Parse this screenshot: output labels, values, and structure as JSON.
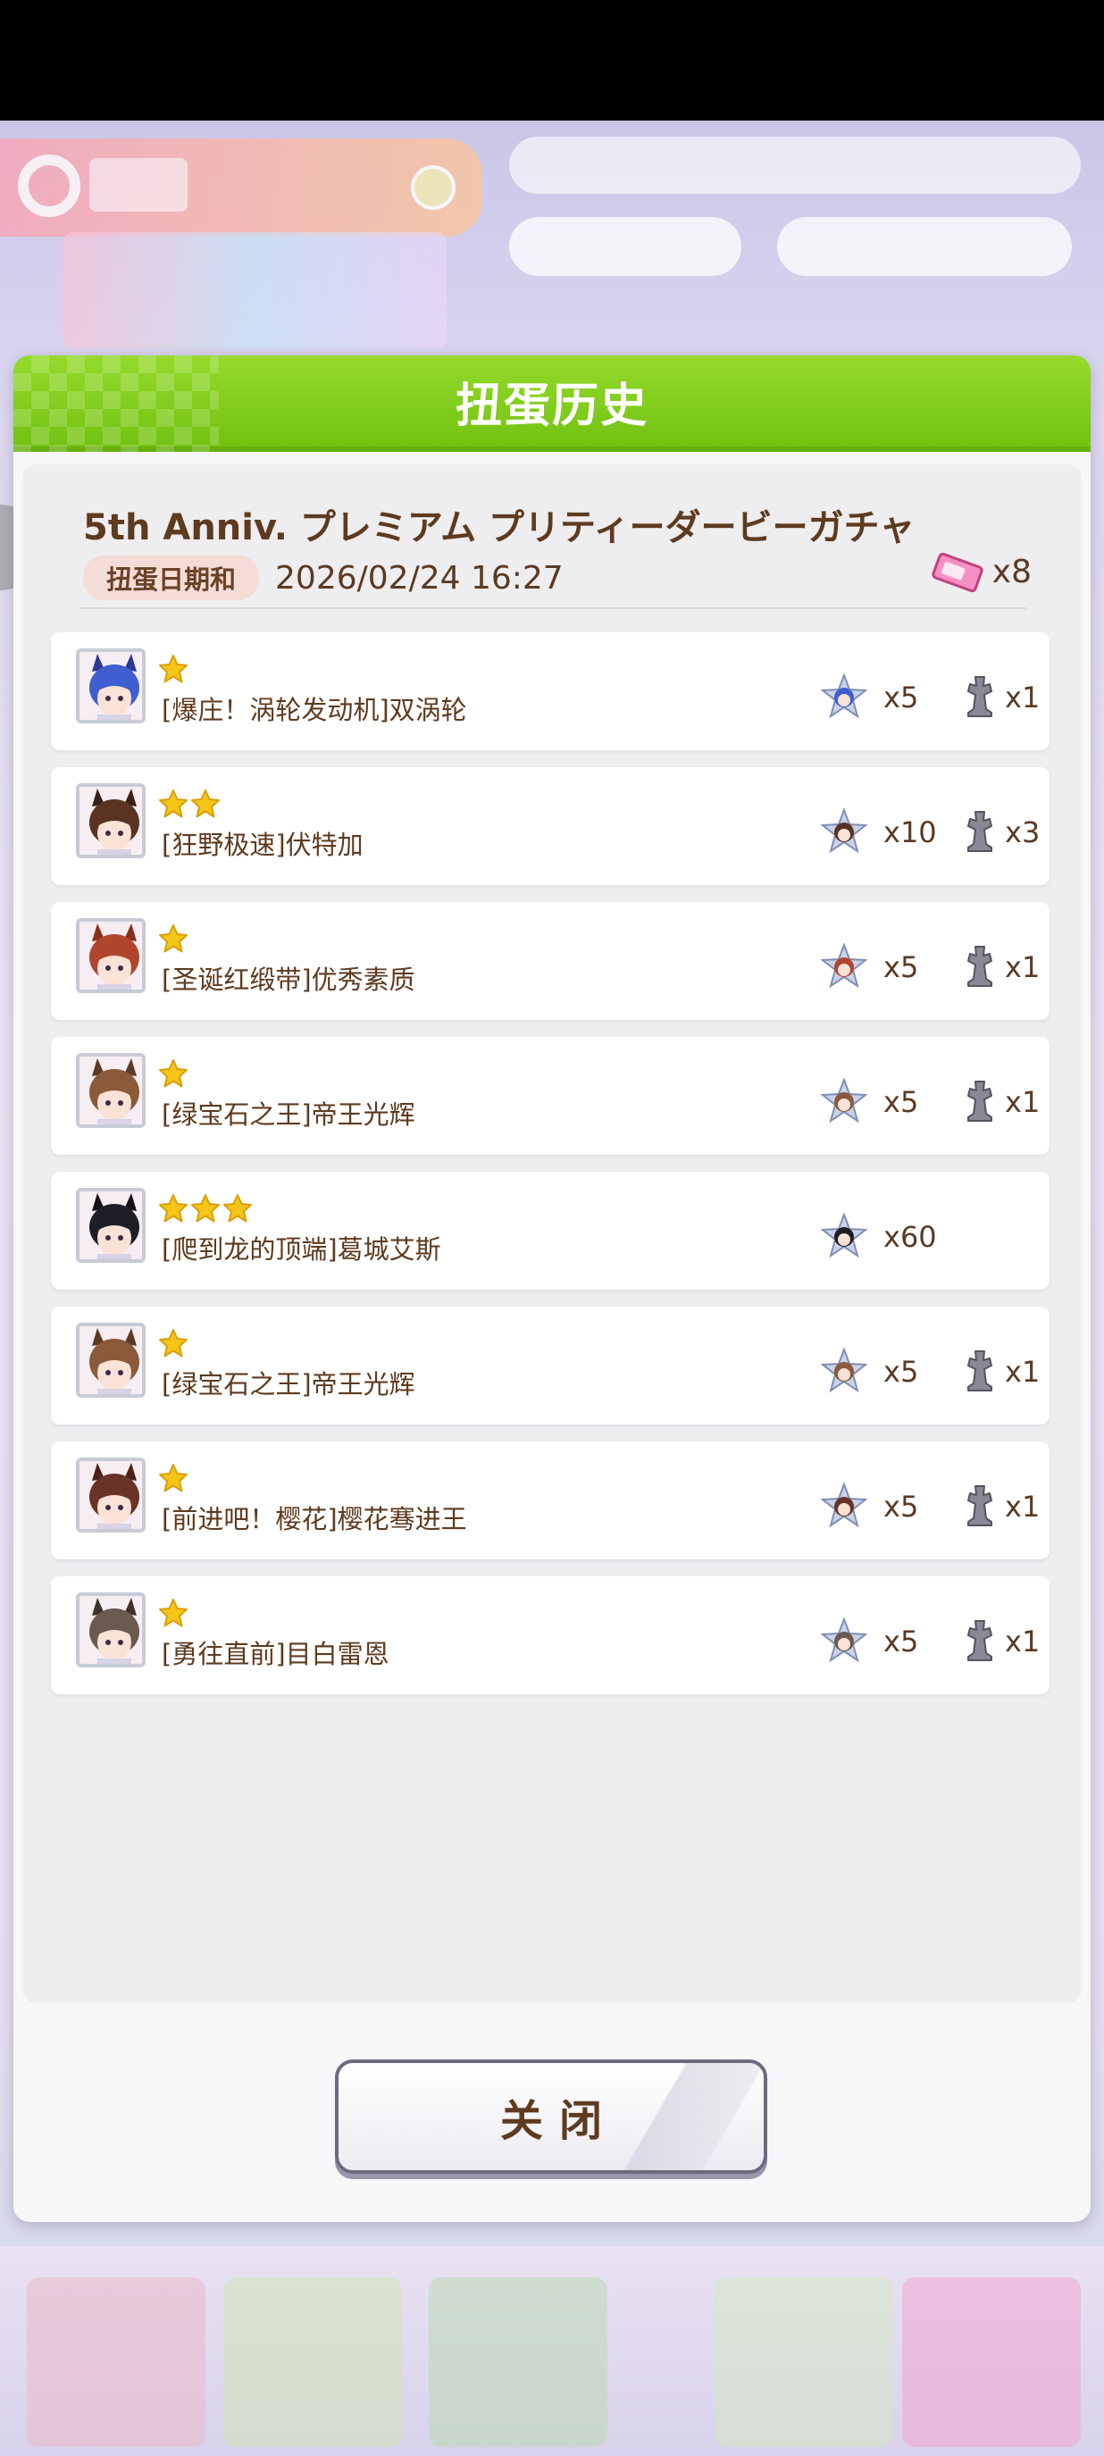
{
  "modal": {
    "title": "扭蛋历史",
    "gacha_name": "5th Anniv. プレミアム プリティーダービーガチャ",
    "date_label": "扭蛋日期和",
    "date_value": "2026/02/24 16:27",
    "ticket_count": "x8",
    "close_label": "关闭"
  },
  "results": [
    {
      "name": "[爆庄！涡轮发动机]双涡轮",
      "stars": 1,
      "pieces": "x5",
      "statues": "x1",
      "hair": "#3f5fd0",
      "ear": "#2b3b96"
    },
    {
      "name": "[狂野极速]伏特加",
      "stars": 2,
      "pieces": "x10",
      "statues": "x3",
      "hair": "#5a3322",
      "ear": "#3a2016"
    },
    {
      "name": "[圣诞红缎带]优秀素质",
      "stars": 1,
      "pieces": "x5",
      "statues": "x1",
      "hair": "#b0452e",
      "ear": "#8a2f1c"
    },
    {
      "name": "[绿宝石之王]帝王光辉",
      "stars": 1,
      "pieces": "x5",
      "statues": "x1",
      "hair": "#8a5a3a",
      "ear": "#5c3a24"
    },
    {
      "name": "[爬到龙的顶端]葛城艾斯",
      "stars": 3,
      "pieces": "x60",
      "statues": "",
      "hair": "#1e1e26",
      "ear": "#111116"
    },
    {
      "name": "[绿宝石之王]帝王光辉",
      "stars": 1,
      "pieces": "x5",
      "statues": "x1",
      "hair": "#8a5a3a",
      "ear": "#5c3a24"
    },
    {
      "name": "[前进吧！樱花]樱花骞进王",
      "stars": 1,
      "pieces": "x5",
      "statues": "x1",
      "hair": "#6a3328",
      "ear": "#4a2018"
    },
    {
      "name": "[勇往直前]目白雷恩",
      "stars": 1,
      "pieces": "x5",
      "statues": "x1",
      "hair": "#6a5a50",
      "ear": "#3e322c"
    }
  ],
  "colors": {
    "header_green": "#7dca19",
    "star_gold": "#f5c518",
    "text_brown": "#5a3a22"
  }
}
